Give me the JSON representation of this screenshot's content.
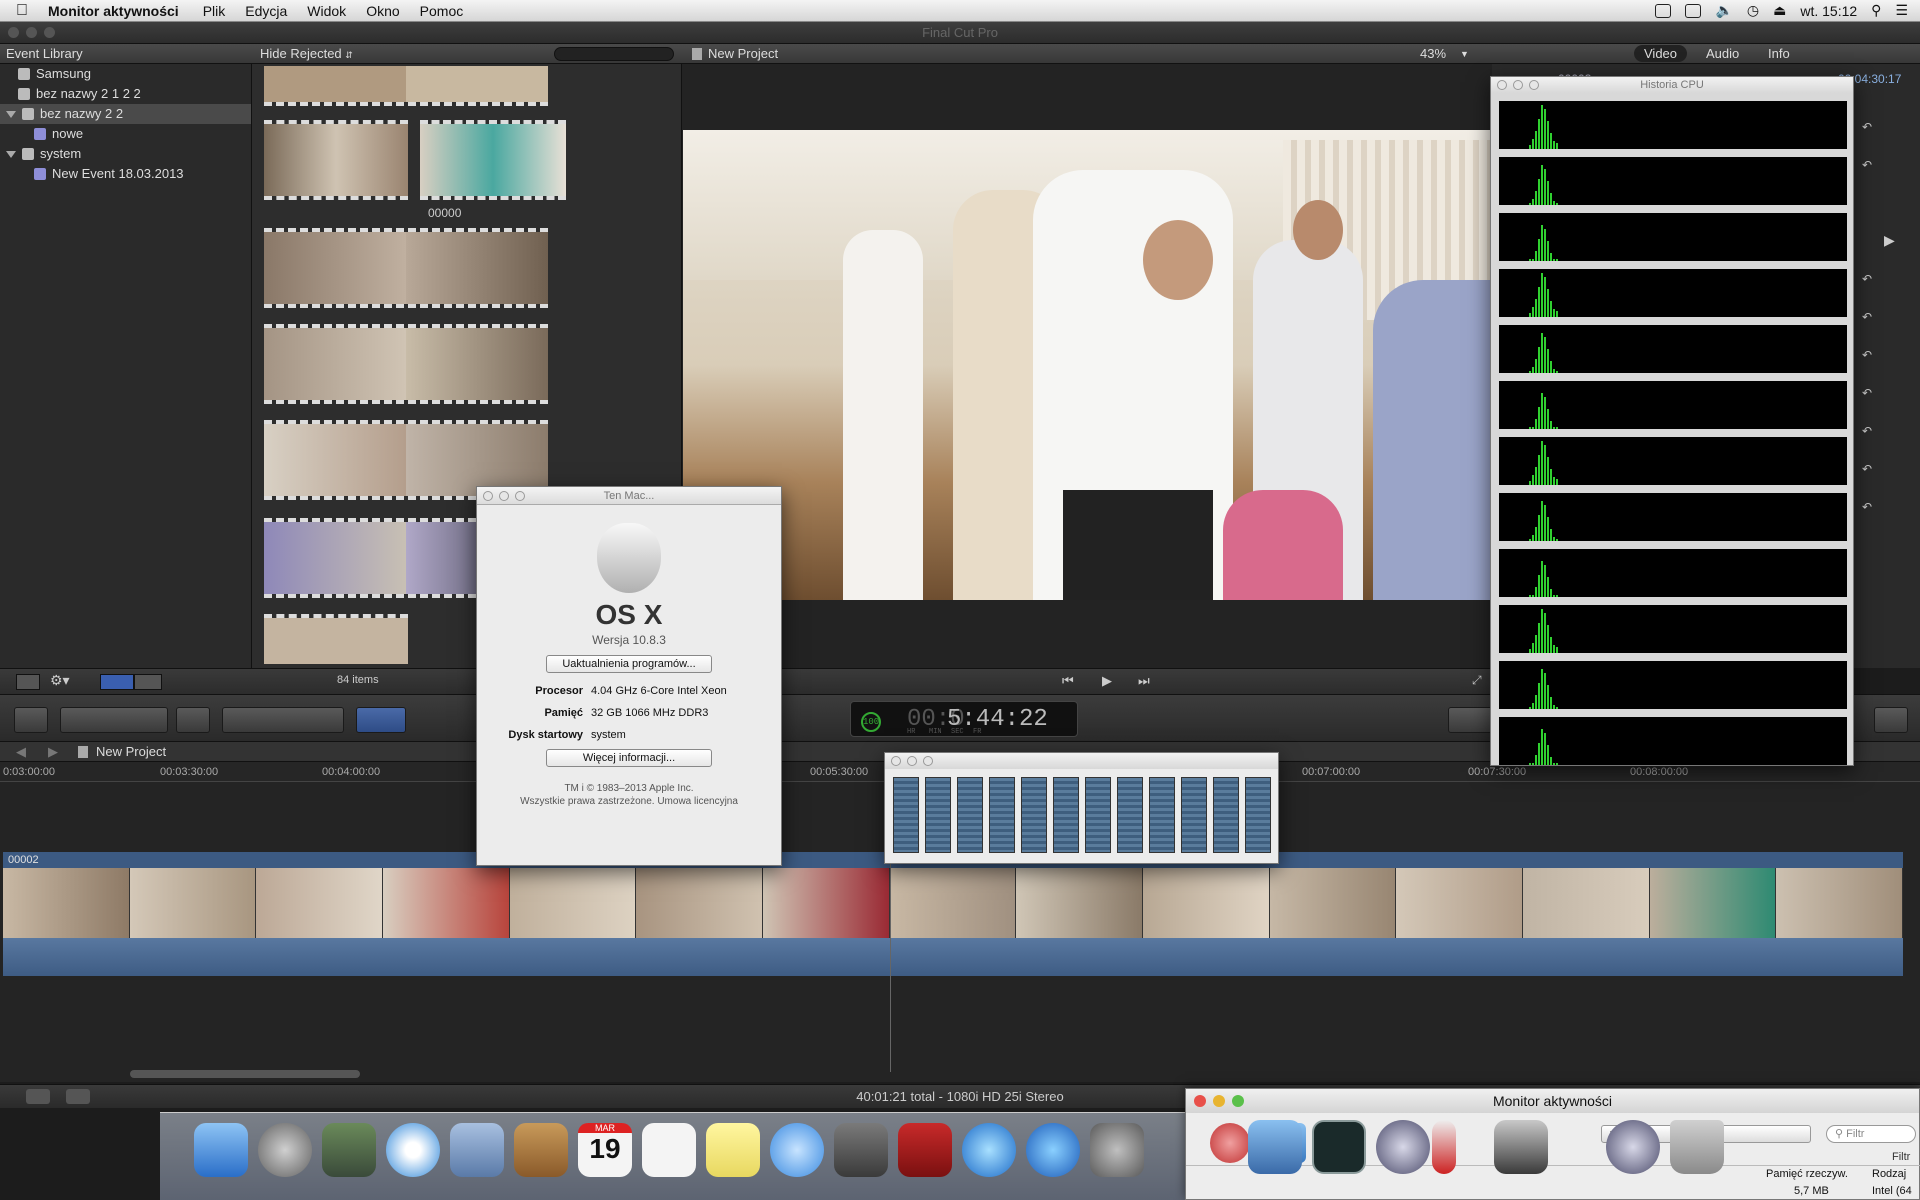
{
  "menubar": {
    "app": "Monitor aktywności",
    "items": [
      "Plik",
      "Edycja",
      "Widok",
      "Okno",
      "Pomoc"
    ],
    "clock": "wt. 15:12"
  },
  "fcp": {
    "title": "Final Cut Pro"
  },
  "library": {
    "header": "Event Library",
    "items": [
      {
        "label": "Samsung",
        "level": 0
      },
      {
        "label": "bez nazwy 2 1 2 2",
        "level": 0
      },
      {
        "label": "bez nazwy 2 2",
        "level": 0,
        "selected": true,
        "expanded": true
      },
      {
        "label": "nowe",
        "level": 1
      },
      {
        "label": "system",
        "level": 0,
        "expanded": true
      },
      {
        "label": "New Event 18.03.2013",
        "level": 1
      }
    ]
  },
  "browser": {
    "filter": "Hide Rejected",
    "clip_label": "00000",
    "count": "84 items"
  },
  "viewer": {
    "title": "New Project",
    "zoom": "43%"
  },
  "inspector": {
    "tabs": [
      "Video",
      "Audio",
      "Info"
    ],
    "clip": "00003",
    "timecode": "00:04:30:17"
  },
  "toolbar": {
    "timecode": "5:44:22",
    "timecode_dim": "00:0",
    "percent": "100",
    "tc_labels": [
      "HR",
      "MIN",
      "SEC",
      "FR"
    ]
  },
  "timeline": {
    "project": "New Project",
    "ruler": [
      "0:03:00:00",
      "00:03:30:00",
      "00:04:00:00",
      "00:05:30:00",
      "00:07:00:00",
      "00:07:30:00",
      "00:08:00:00"
    ],
    "clip_name": "00002"
  },
  "status": {
    "text": "40:01:21 total - 1080i HD 25i Stereo"
  },
  "about": {
    "title": "Ten Mac...",
    "os": "OS X",
    "version": "Wersja 10.8.3",
    "update_btn": "Uaktualnienia programów...",
    "rows": [
      {
        "k": "Procesor",
        "v": "4.04 GHz 6-Core Intel Xeon"
      },
      {
        "k": "Pamięć",
        "v": "32 GB 1066 MHz DDR3"
      },
      {
        "k": "Dysk startowy",
        "v": "system"
      }
    ],
    "more_btn": "Więcej informacji...",
    "footer1": "TM i © 1983–2013 Apple Inc.",
    "footer2": "Wszystkie prawa zastrzeżone.  Umowa licencyjna"
  },
  "cpu_history": {
    "title": "Historia CPU"
  },
  "activity_monitor": {
    "title": "Monitor aktywności",
    "filter_placeholder": "Filtr",
    "filter_label": "Filtr",
    "col1": "Pamięć rzeczyw.",
    "col2": "Rodzaj",
    "val1": "5,7 MB",
    "val2": "Intel (64"
  },
  "dock": {
    "calendar_month": "MAR",
    "calendar_day": "19"
  }
}
